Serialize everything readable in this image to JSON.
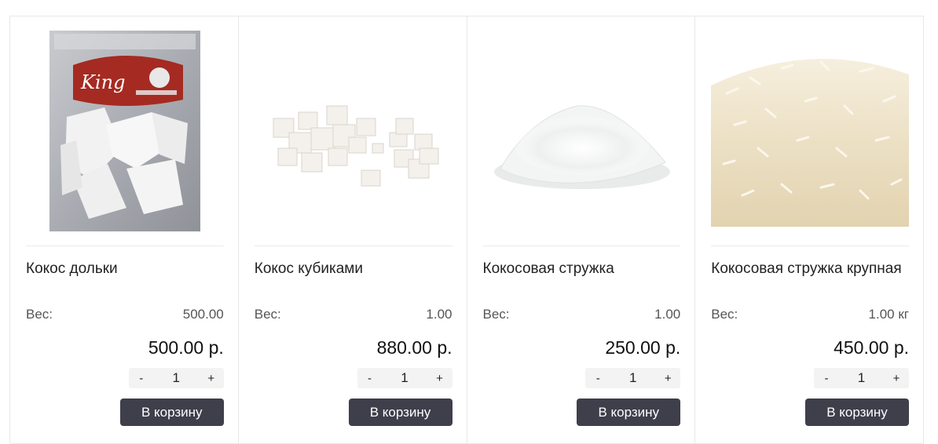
{
  "products": [
    {
      "name": "Кокос дольки",
      "weight_label": "Вес:",
      "weight_value": "500.00",
      "price": "500.00 р.",
      "quantity": "1",
      "minus": "-",
      "plus": "+",
      "cart_label": "В корзину",
      "image_caption": "King"
    },
    {
      "name": "Кокос кубиками",
      "weight_label": "Вес:",
      "weight_value": "1.00",
      "price": "880.00 р.",
      "quantity": "1",
      "minus": "-",
      "plus": "+",
      "cart_label": "В корзину"
    },
    {
      "name": "Кокосовая стружка",
      "weight_label": "Вес:",
      "weight_value": "1.00",
      "price": "250.00 р.",
      "quantity": "1",
      "minus": "-",
      "plus": "+",
      "cart_label": "В корзину"
    },
    {
      "name": "Кокосовая стружка крупная",
      "weight_label": "Вес:",
      "weight_value": "1.00 кг",
      "price": "450.00 р.",
      "quantity": "1",
      "minus": "-",
      "plus": "+",
      "cart_label": "В корзину"
    }
  ],
  "colors": {
    "button_bg": "#3f3e4b",
    "button_text": "#ffffff",
    "stepper_bg": "#f3f3f3",
    "border": "#e8e8e8"
  }
}
